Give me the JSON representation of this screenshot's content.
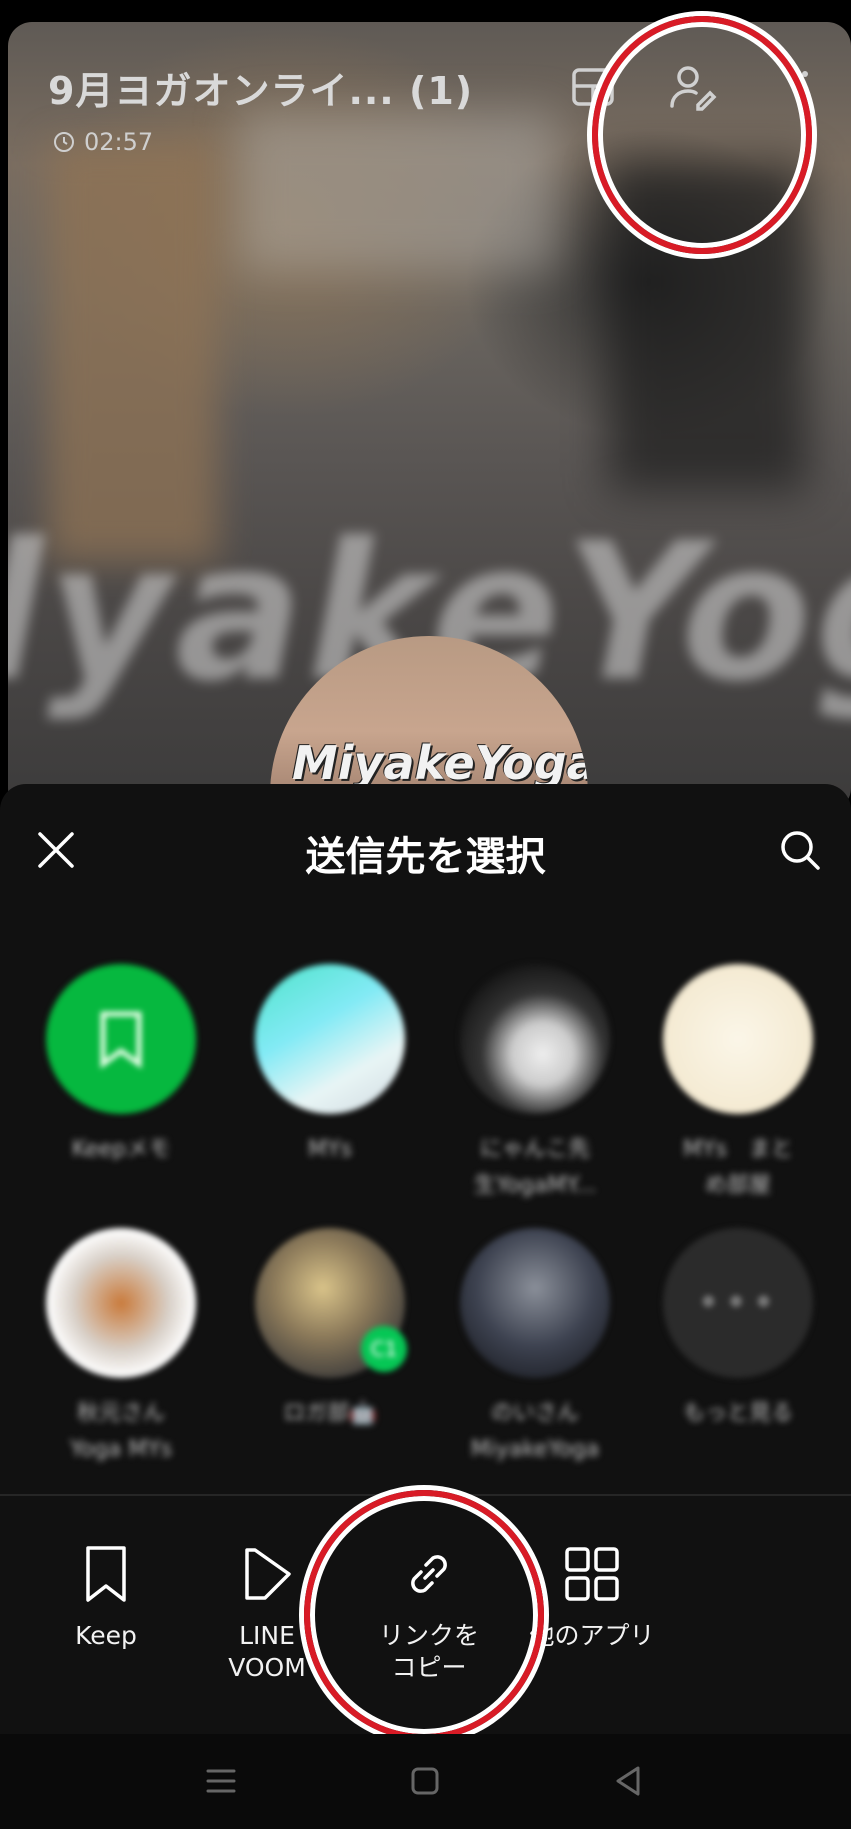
{
  "call": {
    "title": "9月ヨガオンライ... (1)",
    "timer": "02:57",
    "watermark": "lyakeYog",
    "group_logo": "MiyakeYoga"
  },
  "sheet": {
    "title": "送信先を選択",
    "friends": [
      {
        "name_line1": "Keepメモ",
        "name_line2": "",
        "icon": "keep-bookmark-icon"
      },
      {
        "name_line1": "MYs",
        "name_line2": ""
      },
      {
        "name_line1": "にゃんこ先",
        "name_line2": "生YogaMY..."
      },
      {
        "name_line1": "MYs　まと",
        "name_line2": "め部屋"
      },
      {
        "name_line1": "秋元さん",
        "name_line2": "Yoga MYs"
      },
      {
        "name_line1": "ロガ部🤖",
        "name_line2": "",
        "badge": "C1"
      },
      {
        "name_line1": "のいさん",
        "name_line2": "MiyakeYoga"
      },
      {
        "name_line1": "もっと見る",
        "name_line2": "",
        "icon": "more-dots-icon"
      }
    ],
    "share_options": [
      {
        "label_line1": "Keep",
        "label_line2": ""
      },
      {
        "label_line1": "LINE",
        "label_line2": "VOOM"
      },
      {
        "label_line1": "リンクを",
        "label_line2": "コピー"
      },
      {
        "label_line1": "他のアプリ",
        "label_line2": ""
      }
    ]
  },
  "colors": {
    "accent_green": "#06c755",
    "annotation_red": "#d81b26",
    "sheet_bg": "#111111"
  }
}
